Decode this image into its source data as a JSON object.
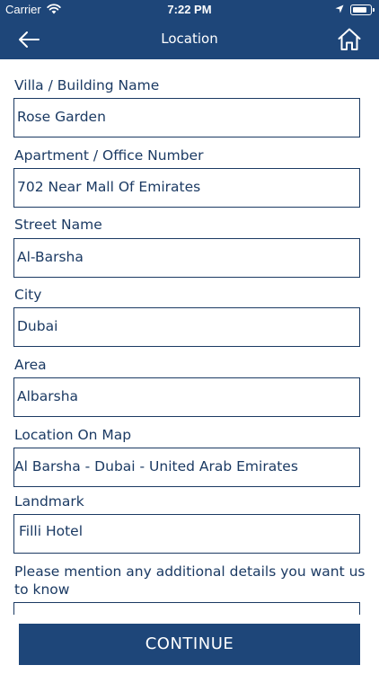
{
  "status_bar": {
    "carrier": "Carrier",
    "time": "7:22 PM"
  },
  "header": {
    "title": "Location"
  },
  "form": {
    "building_label": "Villa / Building Name",
    "building_value": "Rose Garden",
    "apartment_label": "Apartment / Office Number",
    "apartment_value": "702 Near Mall Of Emirates",
    "street_label": "Street Name",
    "street_value": "Al-Barsha",
    "city_label": "City",
    "city_value": "Dubai",
    "area_label": "Area",
    "area_value": "Albarsha",
    "map_label": "Location On Map",
    "map_value": "Al Barsha - Dubai - United Arab Emirates",
    "landmark_label": "Landmark",
    "landmark_value": "Filli Hotel",
    "details_label": "Please mention any additional details you want us to know"
  },
  "actions": {
    "continue_label": "CONTINUE"
  },
  "colors": {
    "primary": "#1e4679",
    "text": "#1b3a63",
    "background": "#ffffff"
  },
  "icons": {
    "back": "back-arrow-icon",
    "home": "home-icon",
    "wifi": "wifi-icon",
    "location": "location-arrow-icon",
    "battery": "battery-icon"
  }
}
